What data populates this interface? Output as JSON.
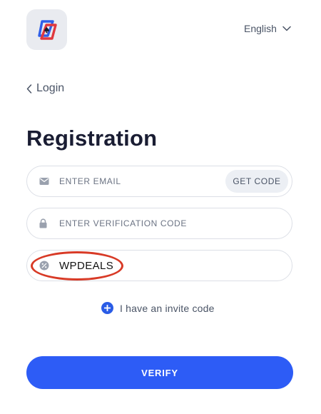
{
  "header": {
    "logo_icon": "card-spade-logo-icon",
    "language": {
      "selected": "English",
      "icon": "chevron-down-icon"
    }
  },
  "nav": {
    "back_label": "Login",
    "back_icon": "chevron-left-icon"
  },
  "form": {
    "title": "Registration",
    "email": {
      "placeholder": "ENTER EMAIL",
      "value": "",
      "icon": "envelope-icon",
      "get_code_label": "GET CODE"
    },
    "verification": {
      "placeholder": "ENTER VERIFICATION CODE",
      "value": "",
      "icon": "lock-icon"
    },
    "promo": {
      "value": "WPDEALS",
      "icon": "percent-badge-icon",
      "highlighted": true
    },
    "invite": {
      "label": "I have an invite code",
      "icon": "plus-circle-icon"
    },
    "verify_label": "VERIFY"
  },
  "colors": {
    "accent": "#2d5cf6",
    "logo_red": "#e0393e",
    "logo_blue": "#2f5fe8",
    "highlight": "#d83a26"
  }
}
